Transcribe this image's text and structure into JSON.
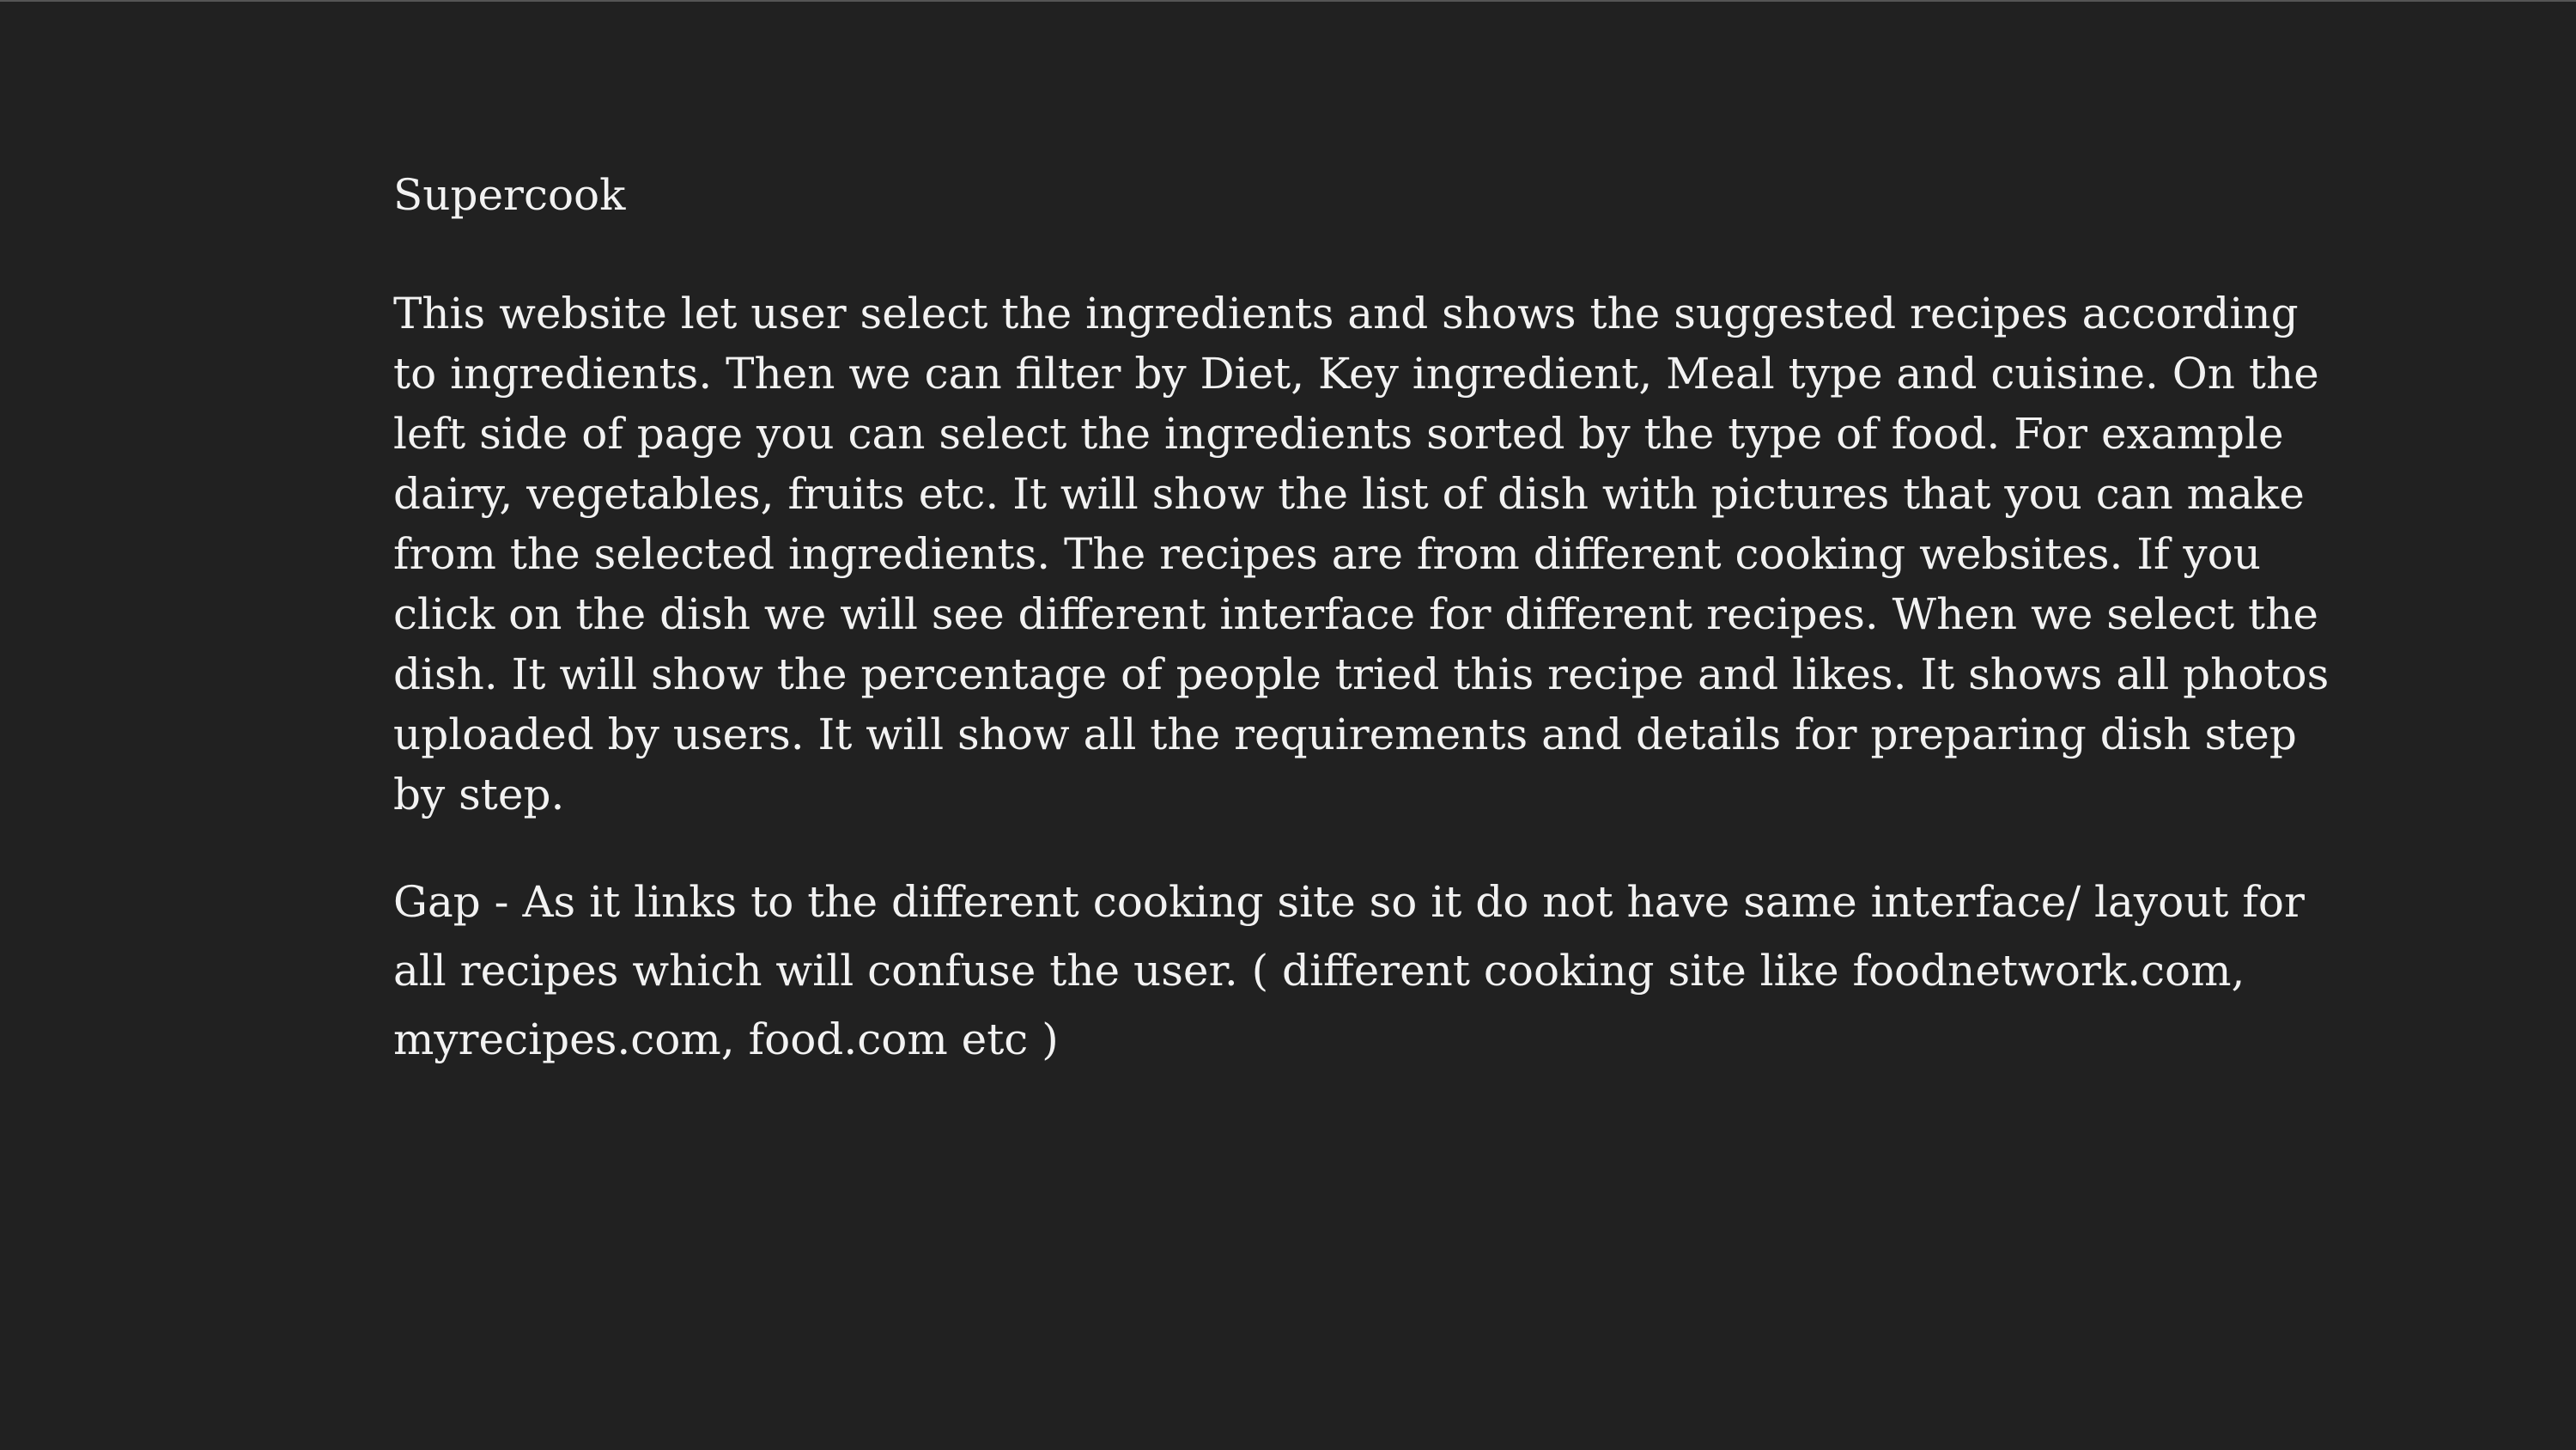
{
  "slide": {
    "title": "Supercook",
    "description": "This website let user select the ingredients and shows the suggested recipes according to ingredients. Then we can filter by Diet, Key ingredient, Meal type and cuisine. On the left side of page you can select the ingredients sorted by the type of food. For example dairy, vegetables, fruits etc. It will show the list of dish with pictures that you can make from the selected ingredients. The recipes are from different cooking websites. If you click on the dish we will see different interface for different recipes. When we select the dish. It will show the percentage of people tried this recipe and likes. It shows all photos uploaded by users. It will show all the requirements and details for preparing dish step by step.",
    "gap": "Gap - As it links to the different cooking site so it do not have same interface/ layout for all recipes which will confuse the user. ( different cooking site like foodnetwork.com, myrecipes.com, food.com etc )"
  },
  "colors": {
    "background": "#212121",
    "text": "#f2f2f2"
  }
}
